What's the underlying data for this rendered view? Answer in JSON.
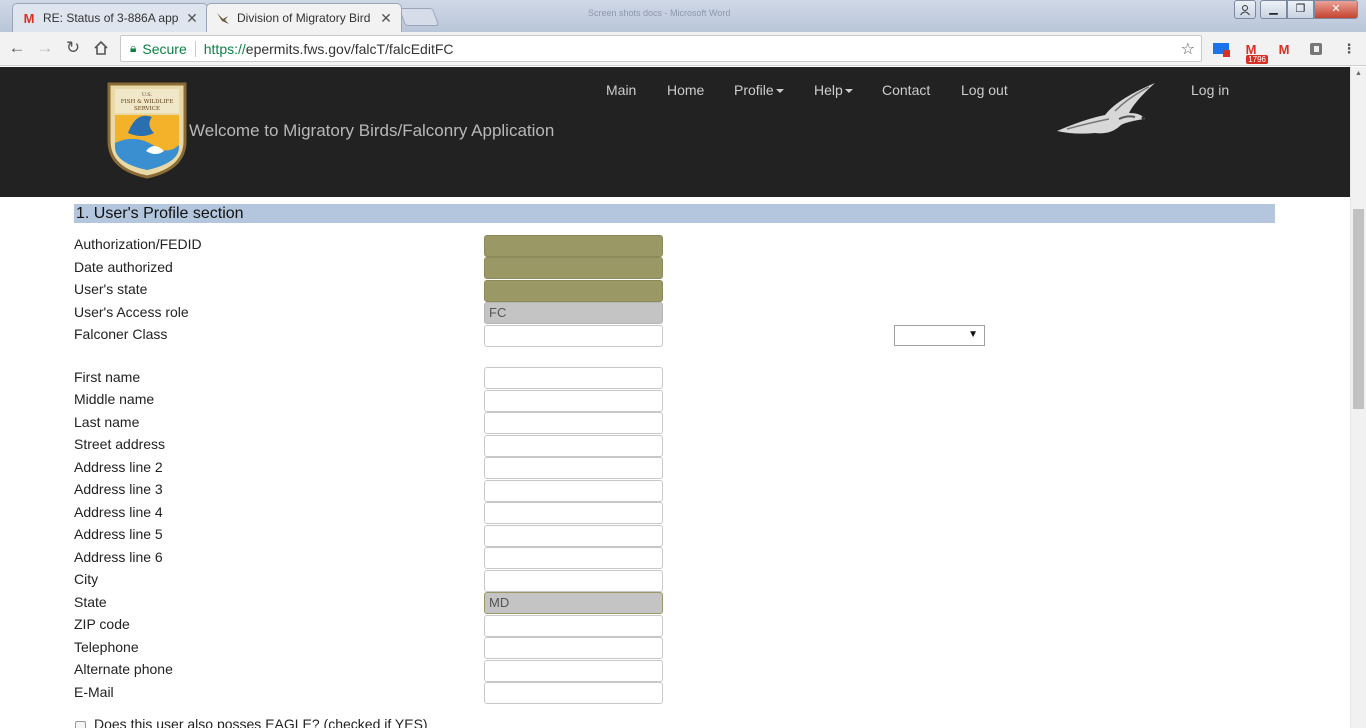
{
  "browser": {
    "tabs": [
      {
        "title": "RE: Status of 3-886A app",
        "favicon": "gmail-icon",
        "active": false
      },
      {
        "title": "Division of Migratory Bird",
        "favicon": "bird-icon",
        "active": true
      }
    ],
    "window_title_blurred": "Screen shots docs - Microsoft Word",
    "address": {
      "security_label": "Secure",
      "url_scheme": "https://",
      "url_rest": "epermits.fws.gov/falcT/falcEditFC"
    },
    "extensions": {
      "gmail_badge": "1796"
    }
  },
  "header": {
    "welcome": "Welcome to Migratory Birds/Falconry Application",
    "nav": {
      "main": "Main",
      "home": "Home",
      "profile": "Profile",
      "help": "Help",
      "contact": "Contact",
      "logout": "Log out",
      "login": "Log in"
    },
    "logo_text": "U.S. FISH & WILDLIFE SERVICE"
  },
  "form": {
    "section_title": "1. User's Profile section",
    "fields": {
      "fedid": {
        "label": "Authorization/FEDID",
        "value": ""
      },
      "date_authorized": {
        "label": "Date authorized",
        "value": ""
      },
      "user_state": {
        "label": "User's state",
        "value": ""
      },
      "access_role": {
        "label": "User's Access role",
        "value": "FC"
      },
      "falconer_class": {
        "label": "Falconer Class",
        "value": "",
        "select_value": ""
      },
      "first_name": {
        "label": "First name",
        "value": ""
      },
      "middle_name": {
        "label": "Middle name",
        "value": ""
      },
      "last_name": {
        "label": "Last name",
        "value": ""
      },
      "street": {
        "label": "Street address",
        "value": ""
      },
      "addr2": {
        "label": "Address line 2",
        "value": ""
      },
      "addr3": {
        "label": "Address line 3",
        "value": ""
      },
      "addr4": {
        "label": "Address line 4",
        "value": ""
      },
      "addr5": {
        "label": "Address line 5",
        "value": ""
      },
      "addr6": {
        "label": "Address line 6",
        "value": ""
      },
      "city": {
        "label": "City",
        "value": ""
      },
      "state": {
        "label": "State",
        "value": "MD"
      },
      "zip": {
        "label": "ZIP code",
        "value": ""
      },
      "telephone": {
        "label": "Telephone",
        "value": ""
      },
      "alt_phone": {
        "label": "Alternate phone",
        "value": ""
      },
      "email": {
        "label": "E-Mail",
        "value": ""
      }
    },
    "eagle_checkbox_label": "Does this user also posses EAGLE? (checked if YES)"
  },
  "colors": {
    "header_bg": "#222222",
    "section_bar": "#b3c6dd",
    "readonly_olive": "#9a9864",
    "readonly_grey": "#c4c4c4",
    "secure_green": "#0b8043"
  }
}
